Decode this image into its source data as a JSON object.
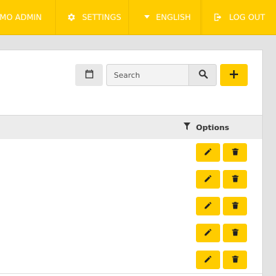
{
  "nav": {
    "admin_label": "EMO ADMIN",
    "settings_label": "SETTINGS",
    "language_label": "ENGLISH",
    "logout_label": "LOG OUT"
  },
  "toolbar": {
    "search_placeholder": "Search"
  },
  "table": {
    "options_header": "Options",
    "rows": [
      {
        "actions": [
          "edit",
          "delete"
        ]
      },
      {
        "actions": [
          "edit",
          "delete"
        ]
      },
      {
        "actions": [
          "edit",
          "delete"
        ]
      },
      {
        "actions": [
          "edit",
          "delete"
        ]
      },
      {
        "actions": [
          "edit",
          "delete"
        ]
      }
    ]
  },
  "colors": {
    "accent": "#ffcc00",
    "nav_text": "#ffffff",
    "background": "#e3e3e3",
    "panel": "#ffffff"
  },
  "icons": {
    "settings": "gear-icon",
    "language": "caret-down-icon",
    "logout": "logout-icon",
    "calendar": "calendar-icon",
    "search": "search-icon",
    "add": "plus-icon",
    "filter": "filter-icon",
    "edit": "pencil-icon",
    "delete": "trash-icon"
  }
}
